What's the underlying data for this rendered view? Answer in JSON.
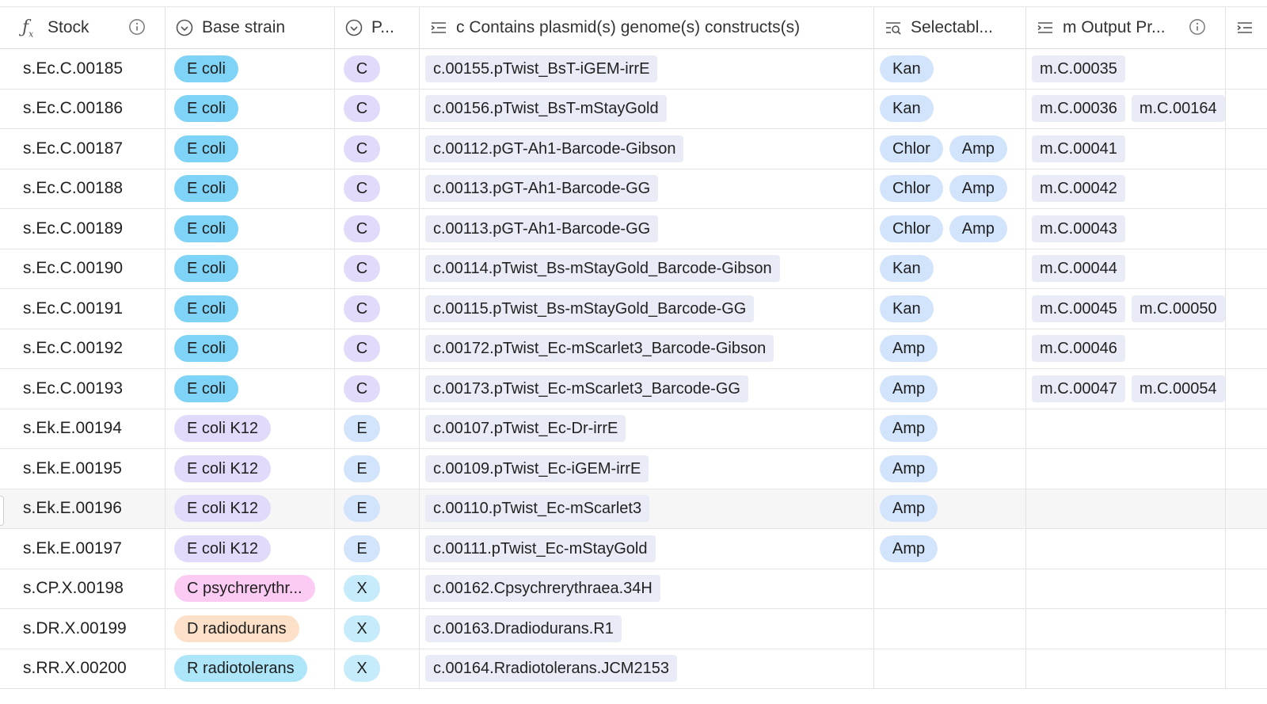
{
  "columns": {
    "stock": "Stock",
    "base_strain": "Base strain",
    "p": "P...",
    "contains": "c Contains plasmid(s) genome(s) constructs(s)",
    "selectable": "Selectabl...",
    "output": "m Output Pr..."
  },
  "colors": {
    "E coli": "#7fd3f7",
    "E coli K12": "#e2dafb",
    "C psychrerythr...": "#fccbf3",
    "D radiodurans": "#fde0c8",
    "R radiotolerans": "#aee6f9",
    "C": "#e2dafb",
    "E": "#d2e3fc",
    "X": "#c6ecfb"
  },
  "rows": [
    {
      "stock": "s.Ec.C.00185",
      "strain": "E coli",
      "p": "C",
      "construct": "c.00155.pTwist_BsT-iGEM-irrE",
      "sel": [
        "Kan"
      ],
      "out": [
        "m.C.00035"
      ]
    },
    {
      "stock": "s.Ec.C.00186",
      "strain": "E coli",
      "p": "C",
      "construct": "c.00156.pTwist_BsT-mStayGold",
      "sel": [
        "Kan"
      ],
      "out": [
        "m.C.00036",
        "m.C.00164"
      ]
    },
    {
      "stock": "s.Ec.C.00187",
      "strain": "E coli",
      "p": "C",
      "construct": "c.00112.pGT-Ah1-Barcode-Gibson",
      "sel": [
        "Chlor",
        "Amp"
      ],
      "out": [
        "m.C.00041"
      ]
    },
    {
      "stock": "s.Ec.C.00188",
      "strain": "E coli",
      "p": "C",
      "construct": "c.00113.pGT-Ah1-Barcode-GG",
      "sel": [
        "Chlor",
        "Amp"
      ],
      "out": [
        "m.C.00042"
      ]
    },
    {
      "stock": "s.Ec.C.00189",
      "strain": "E coli",
      "p": "C",
      "construct": "c.00113.pGT-Ah1-Barcode-GG",
      "sel": [
        "Chlor",
        "Amp"
      ],
      "out": [
        "m.C.00043"
      ]
    },
    {
      "stock": "s.Ec.C.00190",
      "strain": "E coli",
      "p": "C",
      "construct": "c.00114.pTwist_Bs-mStayGold_Barcode-Gibson",
      "sel": [
        "Kan"
      ],
      "out": [
        "m.C.00044"
      ]
    },
    {
      "stock": "s.Ec.C.00191",
      "strain": "E coli",
      "p": "C",
      "construct": "c.00115.pTwist_Bs-mStayGold_Barcode-GG",
      "sel": [
        "Kan"
      ],
      "out": [
        "m.C.00045",
        "m.C.00050"
      ]
    },
    {
      "stock": "s.Ec.C.00192",
      "strain": "E coli",
      "p": "C",
      "construct": "c.00172.pTwist_Ec-mScarlet3_Barcode-Gibson",
      "sel": [
        "Amp"
      ],
      "out": [
        "m.C.00046"
      ]
    },
    {
      "stock": "s.Ec.C.00193",
      "strain": "E coli",
      "p": "C",
      "construct": "c.00173.pTwist_Ec-mScarlet3_Barcode-GG",
      "sel": [
        "Amp"
      ],
      "out": [
        "m.C.00047",
        "m.C.00054"
      ]
    },
    {
      "stock": "s.Ek.E.00194",
      "strain": "E coli K12",
      "p": "E",
      "construct": "c.00107.pTwist_Ec-Dr-irrE",
      "sel": [
        "Amp"
      ],
      "out": []
    },
    {
      "stock": "s.Ek.E.00195",
      "strain": "E coli K12",
      "p": "E",
      "construct": "c.00109.pTwist_Ec-iGEM-irrE",
      "sel": [
        "Amp"
      ],
      "out": []
    },
    {
      "stock": "s.Ek.E.00196",
      "strain": "E coli K12",
      "p": "E",
      "construct": "c.00110.pTwist_Ec-mScarlet3",
      "sel": [
        "Amp"
      ],
      "out": [],
      "highlight": true
    },
    {
      "stock": "s.Ek.E.00197",
      "strain": "E coli K12",
      "p": "E",
      "construct": "c.00111.pTwist_Ec-mStayGold",
      "sel": [
        "Amp"
      ],
      "out": []
    },
    {
      "stock": "s.CP.X.00198",
      "strain": "C psychrerythr...",
      "p": "X",
      "construct": "c.00162.Cpsychrerythraea.34H",
      "sel": [],
      "out": []
    },
    {
      "stock": "s.DR.X.00199",
      "strain": "D radiodurans",
      "p": "X",
      "construct": "c.00163.Dradiodurans.R1",
      "sel": [],
      "out": []
    },
    {
      "stock": "s.RR.X.00200",
      "strain": "R radiotolerans",
      "p": "X",
      "construct": "c.00164.Rradiotolerans.JCM2153",
      "sel": [],
      "out": []
    }
  ]
}
